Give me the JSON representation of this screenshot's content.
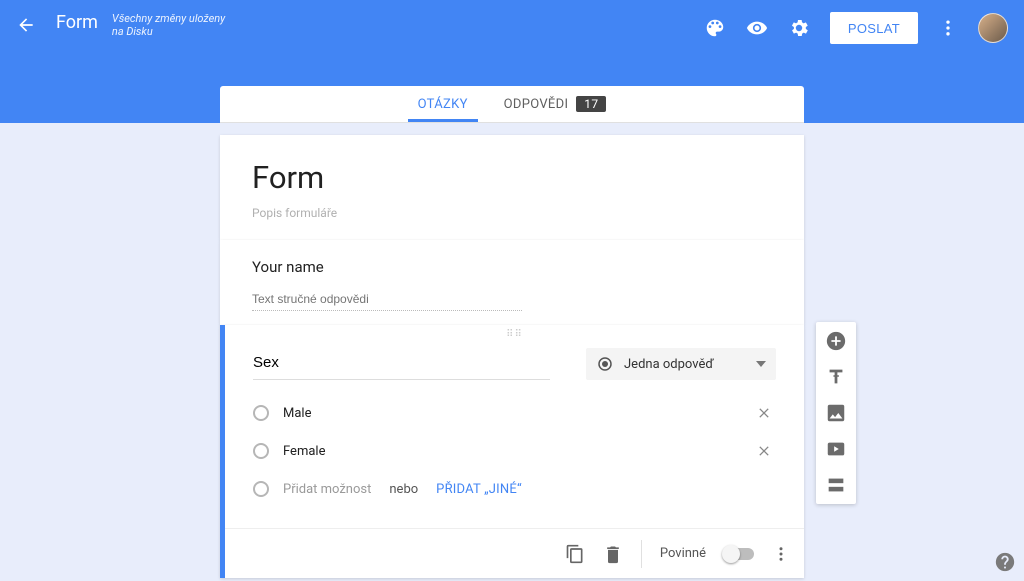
{
  "header": {
    "app_title": "Form",
    "save_state": "Všechny změny uloženy na Disku",
    "send_label": "POSLAT"
  },
  "tabs": {
    "questions": "OTÁZKY",
    "responses": "ODPOVĚDI",
    "responses_count": "17"
  },
  "formHeader": {
    "title": "Form",
    "description_placeholder": "Popis formuláře"
  },
  "question1": {
    "title": "Your name",
    "answer_placeholder": "Text stručné odpovědi"
  },
  "question2": {
    "title": "Sex",
    "type_label": "Jedna odpověď",
    "options": [
      "Male",
      "Female"
    ],
    "add_option_placeholder": "Přidat možnost",
    "or_text": "nebo",
    "add_other_label": "PŘIDAT „JINÉ“",
    "required_label": "Povinné"
  },
  "icons": {
    "back": "arrow-back",
    "palette": "palette",
    "preview": "eye",
    "settings": "gear",
    "more": "more-vert",
    "radio": "radio-checked",
    "chevron": "arrow-drop-down",
    "copy": "copy",
    "delete": "trash",
    "add_question": "plus-circle",
    "add_title": "text-title",
    "add_image": "image",
    "add_video": "video",
    "add_section": "section",
    "help": "help"
  }
}
